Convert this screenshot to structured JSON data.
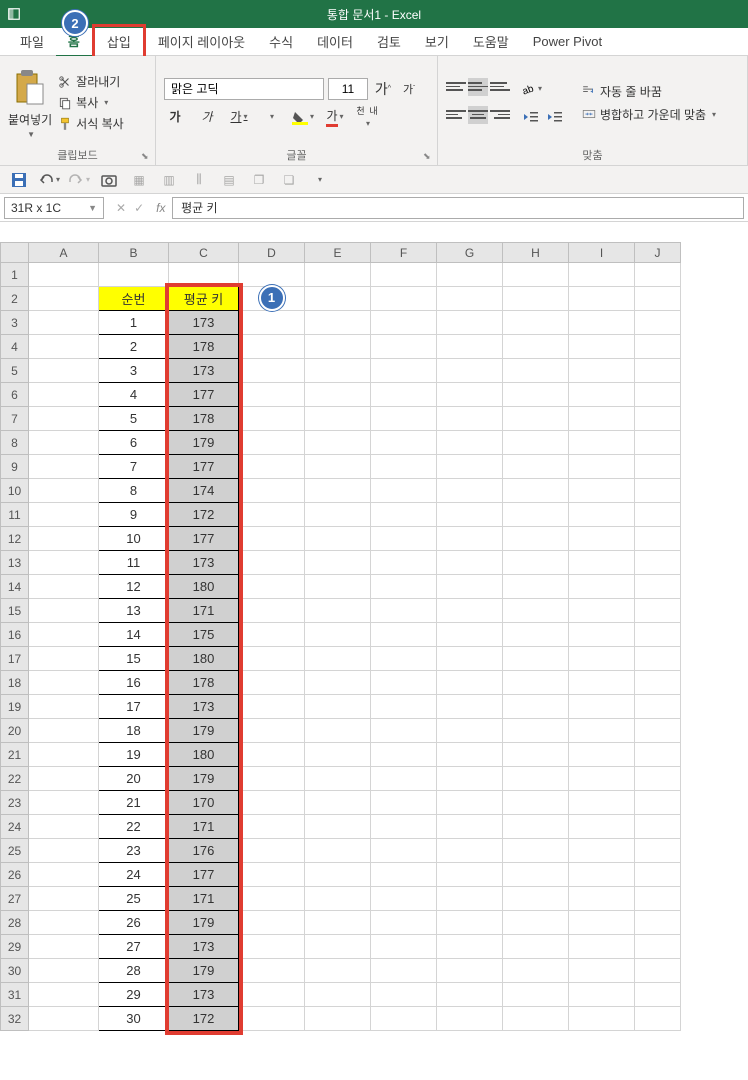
{
  "title": "통합 문서1  -  Excel",
  "tabs": [
    "파일",
    "홈",
    "삽입",
    "페이지 레이아웃",
    "수식",
    "데이터",
    "검토",
    "보기",
    "도움말",
    "Power Pivot"
  ],
  "activeTab": "홈",
  "highlightedTab": "삽입",
  "clipboard": {
    "paste": "붙여넣기",
    "cut": "잘라내기",
    "copy": "복사",
    "format_painter": "서식 복사",
    "group_label": "클립보드"
  },
  "font": {
    "name": "맑은 고딕",
    "size": "11",
    "incr": "가",
    "decr": "가",
    "bold": "가",
    "italic": "가",
    "underline": "가",
    "font_color": "가",
    "ruby": "내천",
    "group_label": "글꼴"
  },
  "alignment": {
    "wrap_text": "자동 줄 바꿈",
    "merge_center": "병합하고 가운데 맞춤",
    "group_label": "맞춤"
  },
  "namebox": "31R x 1C",
  "formula_bar": "평균 키",
  "columns": [
    "A",
    "B",
    "C",
    "D",
    "E",
    "F",
    "G",
    "H",
    "I",
    "J"
  ],
  "chart_data": {
    "type": "table",
    "headers": {
      "b": "순번",
      "c": "평균 키"
    },
    "rows": [
      {
        "n": 1,
        "v": 173
      },
      {
        "n": 2,
        "v": 178
      },
      {
        "n": 3,
        "v": 173
      },
      {
        "n": 4,
        "v": 177
      },
      {
        "n": 5,
        "v": 178
      },
      {
        "n": 6,
        "v": 179
      },
      {
        "n": 7,
        "v": 177
      },
      {
        "n": 8,
        "v": 174
      },
      {
        "n": 9,
        "v": 172
      },
      {
        "n": 10,
        "v": 177
      },
      {
        "n": 11,
        "v": 173
      },
      {
        "n": 12,
        "v": 180
      },
      {
        "n": 13,
        "v": 171
      },
      {
        "n": 14,
        "v": 175
      },
      {
        "n": 15,
        "v": 180
      },
      {
        "n": 16,
        "v": 178
      },
      {
        "n": 17,
        "v": 173
      },
      {
        "n": 18,
        "v": 179
      },
      {
        "n": 19,
        "v": 180
      },
      {
        "n": 20,
        "v": 179
      },
      {
        "n": 21,
        "v": 170
      },
      {
        "n": 22,
        "v": 171
      },
      {
        "n": 23,
        "v": 176
      },
      {
        "n": 24,
        "v": 177
      },
      {
        "n": 25,
        "v": 171
      },
      {
        "n": 26,
        "v": 179
      },
      {
        "n": 27,
        "v": 173
      },
      {
        "n": 28,
        "v": 179
      },
      {
        "n": 29,
        "v": 173
      },
      {
        "n": 30,
        "v": 172
      }
    ]
  },
  "badges": {
    "one": "1",
    "two": "2"
  }
}
